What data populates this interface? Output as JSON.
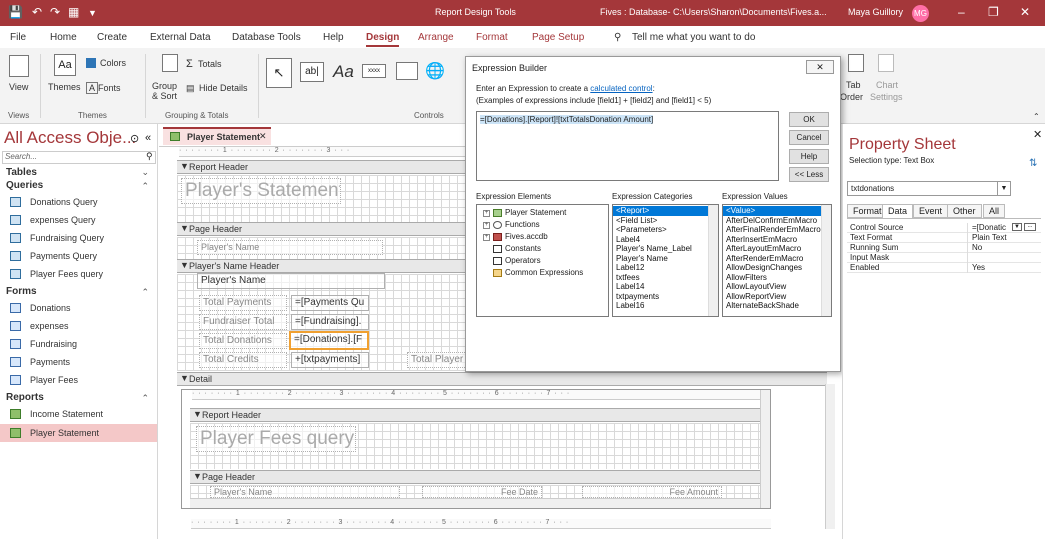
{
  "titlebar": {
    "context": "Report Design Tools",
    "file": "Fives : Database- C:\\Users\\Sharon\\Documents\\Fives.a...",
    "user": "Maya Guillory",
    "initials": "MG",
    "accent": "#a4373a"
  },
  "menu": {
    "tabs": [
      "File",
      "Home",
      "Create",
      "External Data",
      "Database Tools",
      "Help",
      "Design",
      "Arrange",
      "Format",
      "Page Setup"
    ],
    "active": "Design",
    "search_placeholder": "Tell me what you want to do"
  },
  "ribbon": {
    "view": "View",
    "themes": "Themes",
    "colors": "Colors",
    "fonts": "Fonts",
    "group_sort": "Group & Sort",
    "totals": "Totals",
    "hide_details": "Hide Details",
    "tab": "Tab",
    "chart": "Chart",
    "order": "Order",
    "settings": "Settings",
    "groups": {
      "views": "Views",
      "themes": "Themes",
      "grouping": "Grouping & Totals",
      "controls": "Controls"
    }
  },
  "nav": {
    "title": "All Access Obje...",
    "search_placeholder": "Search...",
    "sections": [
      {
        "name": "Tables",
        "collapsed": true,
        "items": []
      },
      {
        "name": "Queries",
        "items": [
          "Donations Query",
          "expenses Query",
          "Fundraising Query",
          "Payments Query",
          "Player Fees query"
        ]
      },
      {
        "name": "Forms",
        "items": [
          "Donations",
          "expenses",
          "Fundraising",
          "Payments",
          "Player Fees"
        ]
      },
      {
        "name": "Reports",
        "items": [
          "Income Statement",
          "Player Statement"
        ]
      }
    ],
    "selected": "Player Statement"
  },
  "doc": {
    "tab": "Player Statement",
    "sections": {
      "report_header": "Report Header",
      "page_header": "Page Header",
      "group_header": "Player's Name Header",
      "detail": "Detail"
    },
    "report_title": "Player's Statement",
    "page_header_label": "Player's Name",
    "group_name_field": "Player's Name",
    "rows": [
      {
        "label": "Total Payments",
        "value": "=[Payments Qu"
      },
      {
        "label": "Fundraiser Total",
        "value": "=[Fundraising]."
      },
      {
        "label": "Total Donations",
        "value": "=[Donations].[F"
      },
      {
        "label": "Total Credits",
        "value": "+[txtpayments]"
      }
    ],
    "extra_label": "Total Player",
    "sub": {
      "report_header": "Report Header",
      "title": "Player Fees query",
      "page_header": "Page Header",
      "cols": [
        "Player's Name",
        "Fee Date",
        "Fee Amount"
      ]
    }
  },
  "expression_builder": {
    "title": "Expression Builder",
    "instruction_prefix": "Enter an Expression to create a",
    "instruction_link": "calculated control",
    "instruction_suffix": ":",
    "example": "(Examples of expressions include [field1] + [field2] and [field1] < 5)",
    "expression": "=[Donations].[Report]![txtTotalsDonation Amount]",
    "buttons": [
      "OK",
      "Cancel",
      "Help",
      "<< Less"
    ],
    "elements_label": "Expression Elements",
    "categories_label": "Expression Categories",
    "values_label": "Expression Values",
    "elements": [
      "Player Statement",
      "Functions",
      "Fives.accdb",
      "Constants",
      "Operators",
      "Common Expressions"
    ],
    "categories": [
      "<Report>",
      "<Field List>",
      "<Parameters>",
      "Label4",
      "Player's Name_Label",
      "Player's Name",
      "Label12",
      "txtfees",
      "Label14",
      "txtpayments",
      "Label16"
    ],
    "values": [
      "<Value>",
      "AfterDelConfirmEmMacro",
      "AfterFinalRenderEmMacro",
      "AfterInsertEmMacro",
      "AfterLayoutEmMacro",
      "AfterRenderEmMacro",
      "AllowDesignChanges",
      "AllowFilters",
      "AllowLayoutView",
      "AllowReportView",
      "AlternateBackShade"
    ]
  },
  "property_sheet": {
    "title": "Property Sheet",
    "selection_type": "Selection type:  Text Box",
    "selector": "txtdonations",
    "tabs": [
      "Format",
      "Data",
      "Event",
      "Other",
      "All"
    ],
    "active_tab": "Data",
    "rows": [
      {
        "name": "Control Source",
        "value": "=[Donatic"
      },
      {
        "name": "Text Format",
        "value": "Plain Text"
      },
      {
        "name": "Running Sum",
        "value": "No"
      },
      {
        "name": "Input Mask",
        "value": ""
      },
      {
        "name": "Enabled",
        "value": "Yes"
      }
    ]
  }
}
